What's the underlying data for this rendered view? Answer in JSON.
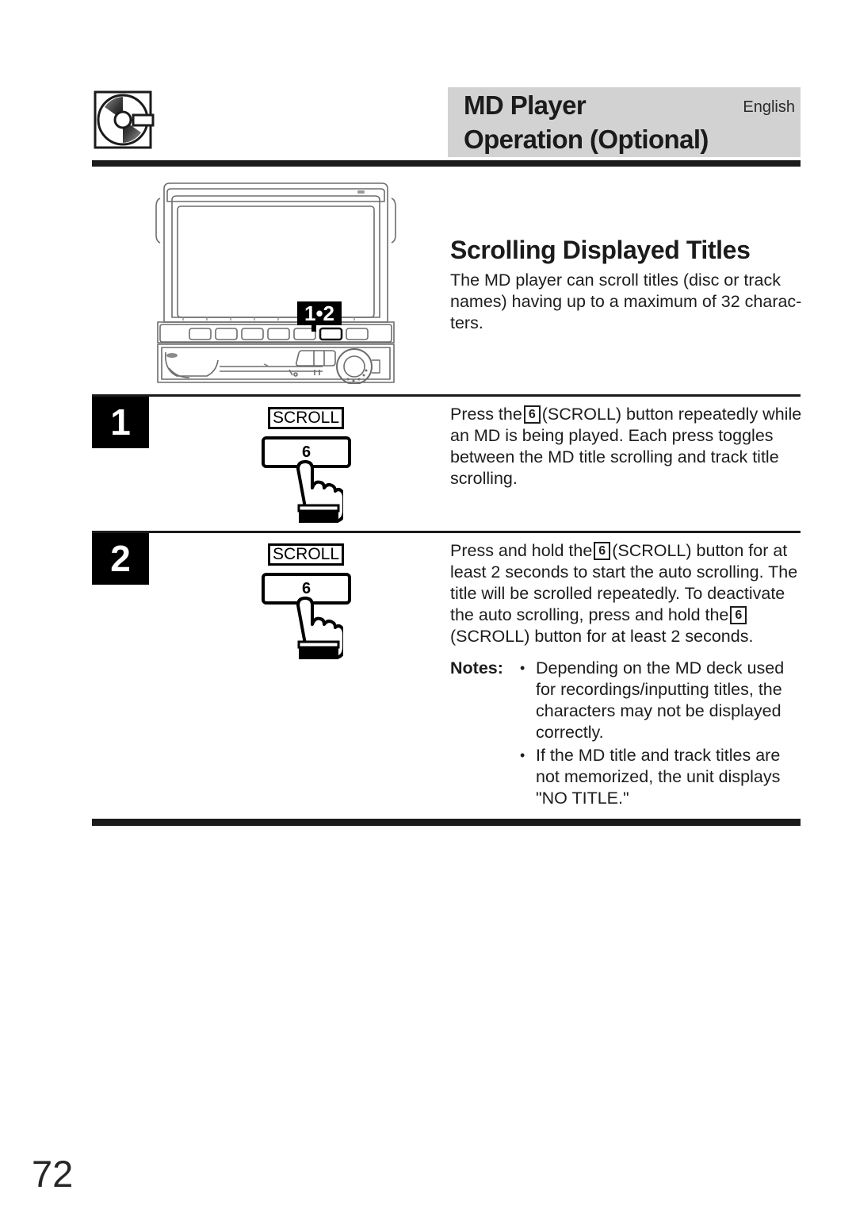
{
  "header": {
    "title_line_1": "MD Player",
    "title_line_2": "Operation (Optional)",
    "language": "English",
    "icon": "minidisc-icon"
  },
  "section": {
    "title": "Scrolling Displayed Titles",
    "intro": "The MD player can scroll titles (disc or track names) having up to a maximum of 32 charac-ters."
  },
  "device": {
    "callout_label": "1•2",
    "name": "car-audio-head-unit"
  },
  "steps": [
    {
      "number": "1",
      "graphic": {
        "label": "SCROLL",
        "key_number": "6",
        "hand": "pointing-hand-icon"
      },
      "text_parts": {
        "a": "Press the",
        "key": "6",
        "b": "(SCROLL) button repeatedly while an MD is being played. Each press toggles between the MD title scrolling and track title scrolling."
      }
    },
    {
      "number": "2",
      "graphic": {
        "label": "SCROLL",
        "key_number": "6",
        "hand": "pointing-hand-icon"
      },
      "text_parts": {
        "a": "Press and hold the",
        "key": "6",
        "b": "(SCROLL) button for at least 2 seconds to start the auto scrolling. The title will be scrolled repeatedly. To deactivate the auto scrolling, press and hold the",
        "key2": "6",
        "c": "(SCROLL) button for at least 2 seconds."
      }
    }
  ],
  "notes": {
    "label": "Notes:",
    "bullet": "•",
    "items": [
      "Depending on the MD deck used for recordings/inputting titles, the characters may not be displayed correctly.",
      "If the MD title and track titles are not memorized, the unit displays \"NO TITLE.\""
    ]
  },
  "page_number": "72",
  "colors": {
    "header_band": "#d2d2d2",
    "rule": "#1b1b1b",
    "badge_bg": "#000000",
    "text": "#1d1d1d"
  }
}
